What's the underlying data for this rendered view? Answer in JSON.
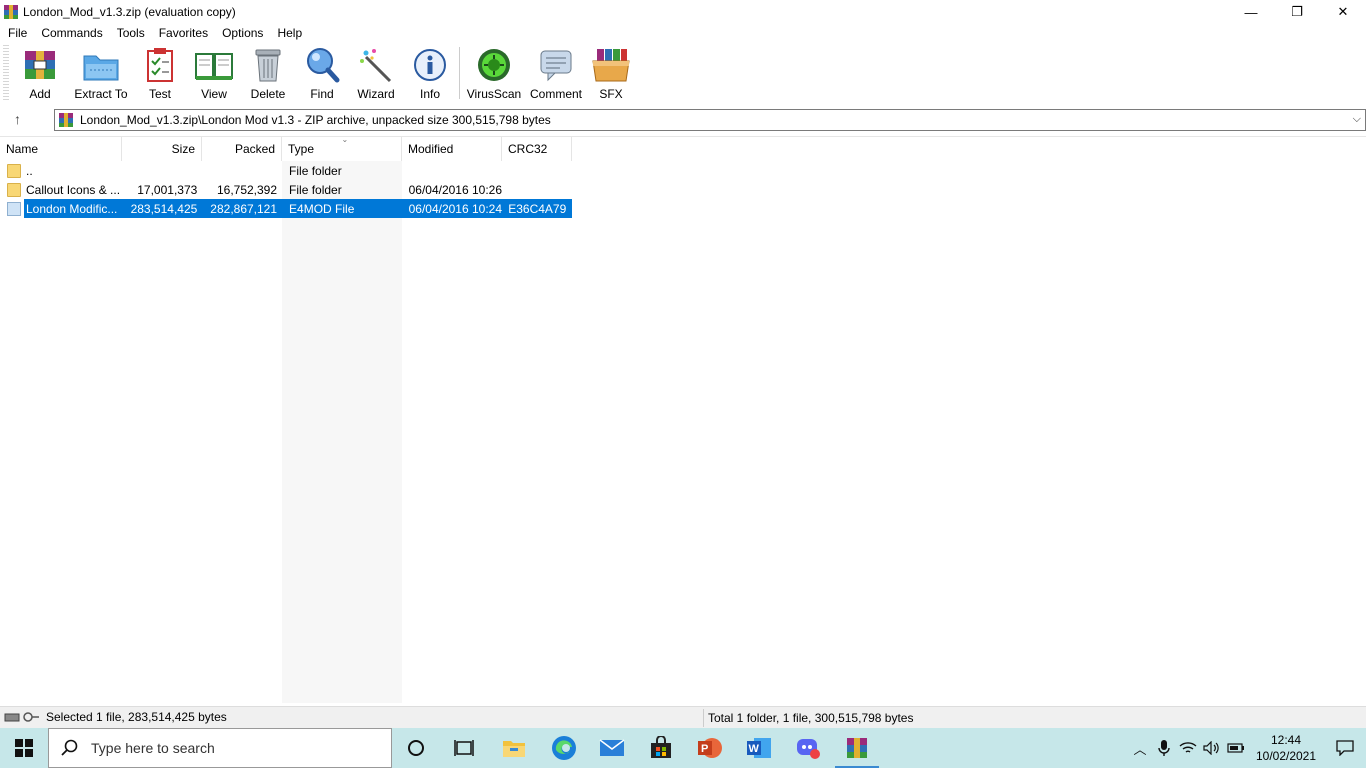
{
  "window": {
    "title": "London_Mod_v1.3.zip (evaluation copy)",
    "minimize": "—",
    "restore": "❐",
    "close": "✕"
  },
  "menu": [
    "File",
    "Commands",
    "Tools",
    "Favorites",
    "Options",
    "Help"
  ],
  "toolbar": {
    "add": "Add",
    "extract_to": "Extract To",
    "test": "Test",
    "view": "View",
    "delete": "Delete",
    "find": "Find",
    "wizard": "Wizard",
    "info": "Info",
    "virusscan": "VirusScan",
    "comment": "Comment",
    "sfx": "SFX"
  },
  "address": {
    "path": "London_Mod_v1.3.zip\\London Mod v1.3 - ZIP archive, unpacked size 300,515,798 bytes"
  },
  "columns": {
    "name": "Name",
    "size": "Size",
    "packed": "Packed",
    "type": "Type",
    "modified": "Modified",
    "crc32": "CRC32"
  },
  "files": [
    {
      "name": "..",
      "size": "",
      "packed": "",
      "type": "File folder",
      "modified": "",
      "crc": "",
      "icon": "folder-icon"
    },
    {
      "name": "Callout Icons & ...",
      "size": "17,001,373",
      "packed": "16,752,392",
      "type": "File folder",
      "modified": "06/04/2016 10:26",
      "crc": "",
      "icon": "folder-icon"
    },
    {
      "name": "London Modific...",
      "size": "283,514,425",
      "packed": "282,867,121",
      "type": "E4MOD File",
      "modified": "06/04/2016 10:24",
      "crc": "E36C4A79",
      "icon": "file-icon"
    }
  ],
  "status": {
    "left": "Selected 1 file, 283,514,425 bytes",
    "right": "Total 1 folder, 1 file, 300,515,798 bytes"
  },
  "taskbar": {
    "search_placeholder": "Type here to search",
    "time": "12:44",
    "date": "10/02/2021"
  },
  "colors": {
    "selection": "#0078d7",
    "taskbar": "#c6e7e9"
  }
}
